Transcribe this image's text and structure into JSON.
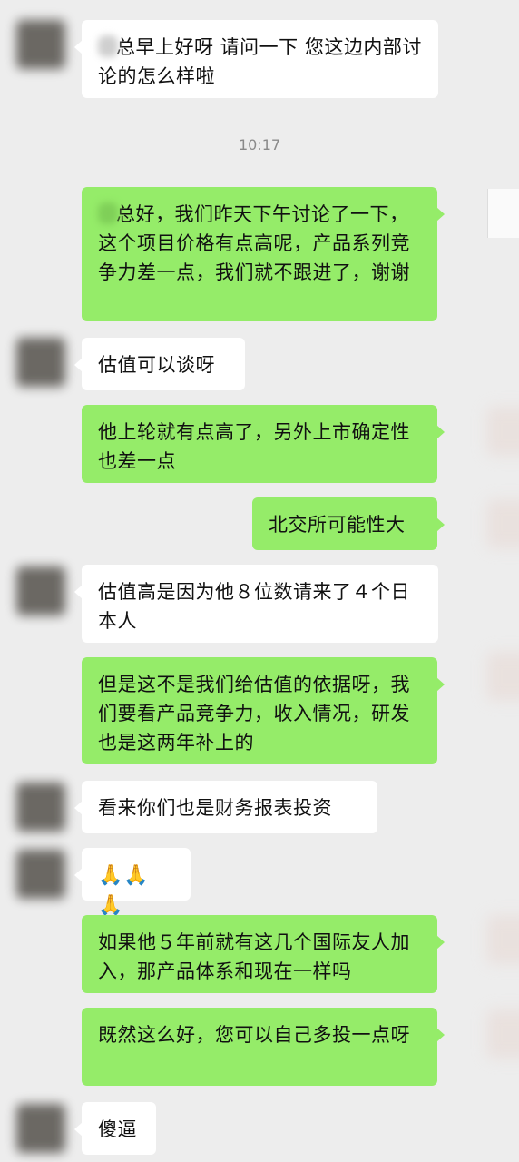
{
  "timestamp": "10:17",
  "messages": [
    {
      "side": "in",
      "text": "总早上好呀 请问一下 您这边内部讨论的怎么样啦",
      "masked_prefix": true
    },
    {
      "side": "out",
      "text": "总好，我们昨天下午讨论了一下，这个项目价格有点高呢，产品系列竞争力差一点，我们就不跟进了，谢谢",
      "masked_prefix": true
    },
    {
      "side": "in",
      "text": "估值可以谈呀"
    },
    {
      "side": "out",
      "text": "他上轮就有点高了，另外上市确定性也差一点"
    },
    {
      "side": "out",
      "text": "北交所可能性大"
    },
    {
      "side": "in",
      "text": "估值高是因为他８位数请来了４个日本人"
    },
    {
      "side": "out",
      "text": "但是这不是我们给估值的依据呀，我们要看产品竞争力，收入情况，研发也是这两年补上的"
    },
    {
      "side": "in",
      "text": "看来你们也是财务报表投资"
    },
    {
      "side": "in",
      "text": "🙏🙏🙏",
      "emoji": true
    },
    {
      "side": "out",
      "text": "如果他５年前就有这几个国际友人加入，那产品体系和现在一样吗"
    },
    {
      "side": "out",
      "text": "既然这么好，您可以自己多投一点呀"
    },
    {
      "side": "in",
      "text": "傻逼"
    }
  ]
}
